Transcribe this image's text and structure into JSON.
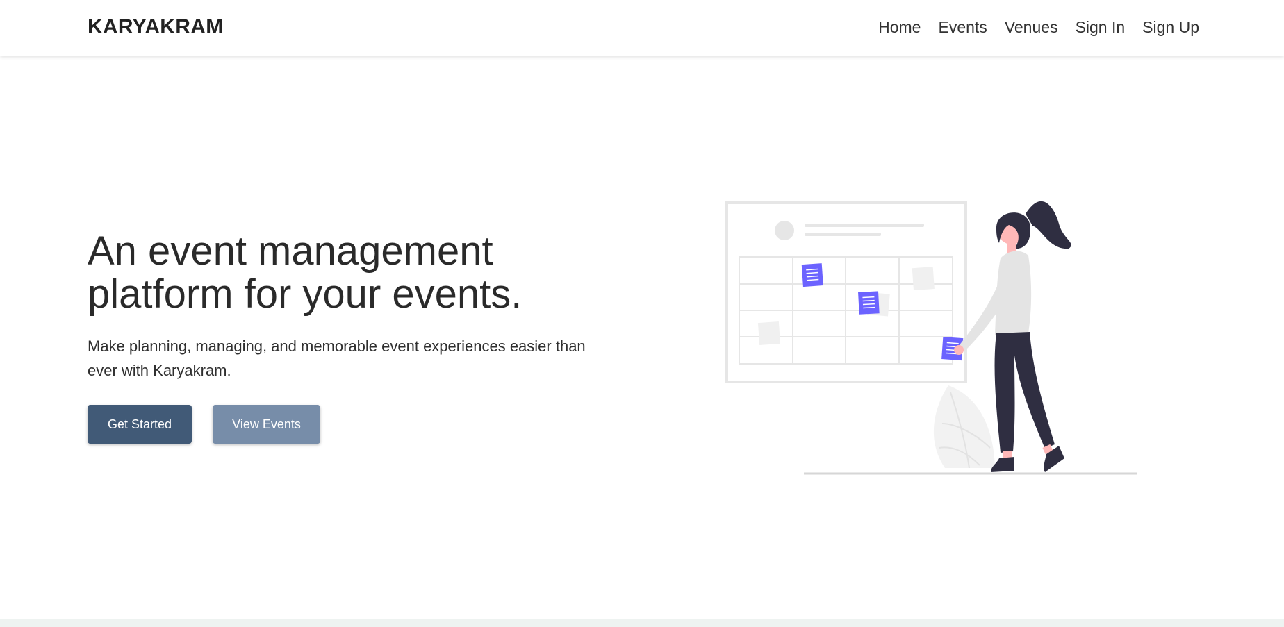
{
  "navbar": {
    "brand": "KARYAKRAM",
    "links": [
      {
        "label": "Home"
      },
      {
        "label": "Events"
      },
      {
        "label": "Venues"
      },
      {
        "label": "Sign In"
      },
      {
        "label": "Sign Up"
      }
    ]
  },
  "hero": {
    "headline": "An event management platform for your events.",
    "subtext": "Make planning, managing, and memorable event experiences easier than ever with Karyakram.",
    "primary_button": "Get Started",
    "secondary_button": "View Events"
  },
  "colors": {
    "primary_button": "#415a77",
    "secondary_button": "#778da9",
    "accent": "#6c63ff",
    "illustration_dark": "#2f2e41"
  },
  "illustration": {
    "description_icon": "woman-calendar-board-illustration"
  }
}
